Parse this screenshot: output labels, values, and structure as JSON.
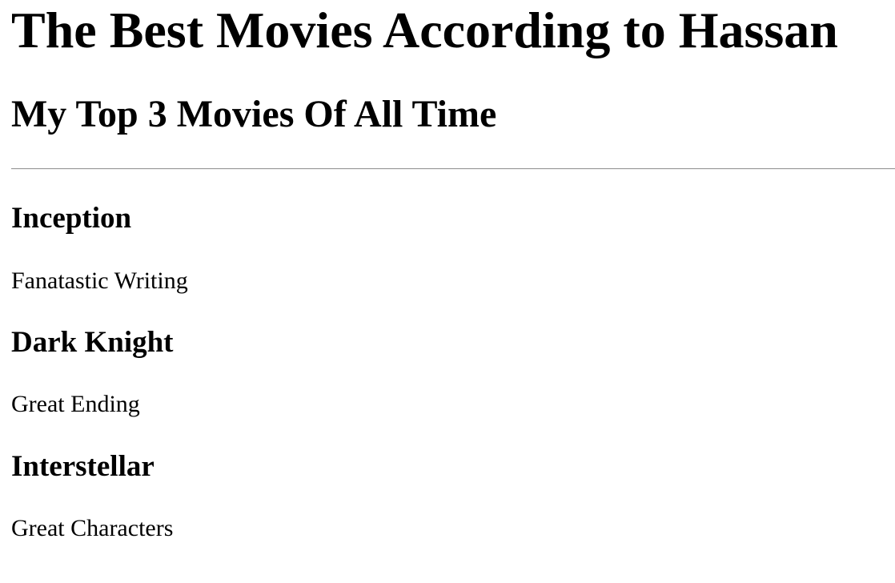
{
  "header": {
    "title": "The Best Movies According to Hassan",
    "subtitle": "My Top 3 Movies Of All Time"
  },
  "movies": [
    {
      "title": "Inception",
      "description": "Fanatastic Writing"
    },
    {
      "title": "Dark Knight",
      "description": "Great Ending"
    },
    {
      "title": "Interstellar",
      "description": "Great Characters"
    }
  ]
}
